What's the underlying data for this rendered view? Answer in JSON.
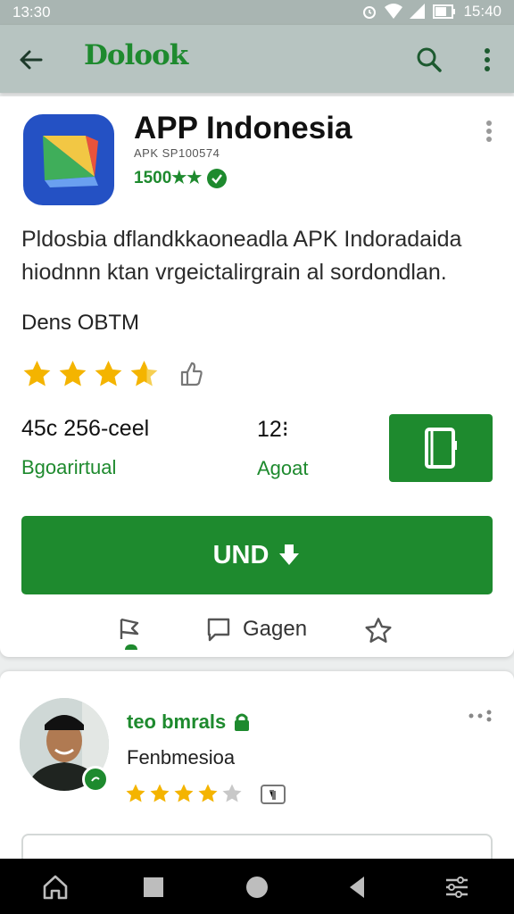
{
  "status_bar": {
    "time_left": "13:30",
    "time_right": "15:40"
  },
  "app_bar": {
    "title": "Dolook"
  },
  "app": {
    "name": "APP Indonesia",
    "subtitle": "APK SP100574",
    "rating_text": "1500★★",
    "description": "Pldosbia dflandkkaoneadla APK Indoradaida hiodnnn ktan vrgeictalirgrain al sordondlan.",
    "section_label": "Dens OBTM",
    "stars": 3.5,
    "stats": [
      {
        "value": "45c 256-ceel",
        "label": "Bgoarirtual"
      },
      {
        "value": "12⁝",
        "label": "Agoat"
      }
    ],
    "install_label": "UND",
    "actions": {
      "share_label": "",
      "comment_label": "Gagen",
      "wishlist_label": ""
    }
  },
  "review": {
    "name": "teo bmrals",
    "subtitle": "Fenbmesioa",
    "stars": 4
  },
  "colors": {
    "accent": "#1e8a2e",
    "star": "#f4b400",
    "star_empty": "#c8c8c8"
  },
  "icons": [
    "back-arrow-icon",
    "search-icon",
    "more-vert-icon",
    "verified-icon",
    "thumb-icon",
    "open-app-icon",
    "download-icon",
    "share-icon",
    "comment-icon",
    "star-outline-icon",
    "lock-icon",
    "home-icon",
    "recents-icon",
    "circle-icon",
    "back-icon",
    "settings-icon"
  ]
}
